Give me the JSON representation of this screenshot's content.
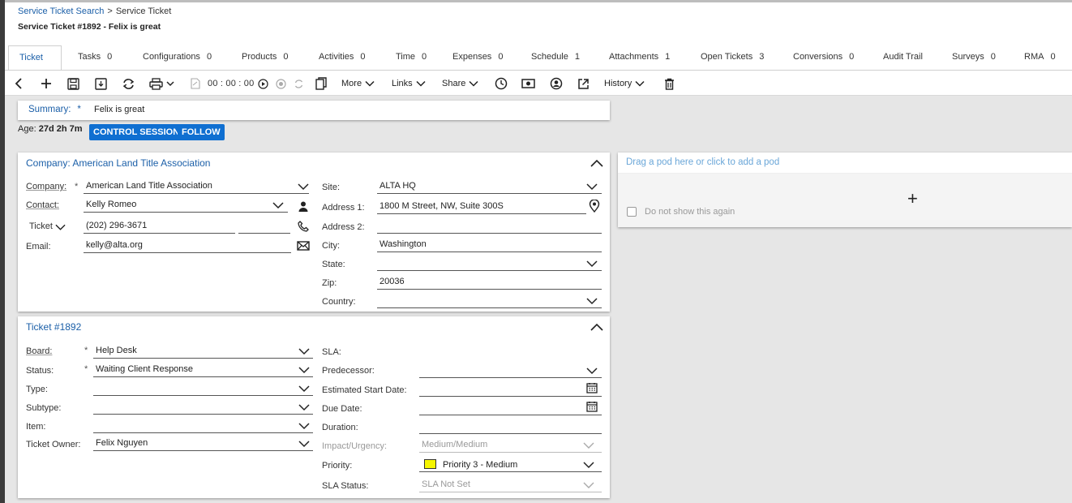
{
  "breadcrumb": {
    "parent": "Service Ticket Search",
    "separator": ">",
    "current": "Service Ticket"
  },
  "page_title": "Service Ticket #1892 - Felix is great",
  "tabs": [
    {
      "label": "Ticket",
      "count": ""
    },
    {
      "label": "Tasks",
      "count": "0"
    },
    {
      "label": "Configurations",
      "count": "0"
    },
    {
      "label": "Products",
      "count": "0"
    },
    {
      "label": "Activities",
      "count": "0"
    },
    {
      "label": "Time",
      "count": "0"
    },
    {
      "label": "Expenses",
      "count": "0"
    },
    {
      "label": "Schedule",
      "count": "1"
    },
    {
      "label": "Attachments",
      "count": "1"
    },
    {
      "label": "Open Tickets",
      "count": "3"
    },
    {
      "label": "Conversions",
      "count": "0"
    },
    {
      "label": "Audit Trail",
      "count": ""
    },
    {
      "label": "Surveys",
      "count": "0"
    },
    {
      "label": "RMA",
      "count": "0"
    }
  ],
  "toolbar": {
    "timer": "00 : 00 : 00",
    "more": "More",
    "links": "Links",
    "share": "Share",
    "history": "History"
  },
  "summary": {
    "label": "Summary:",
    "required": "*",
    "value": "Felix is great"
  },
  "age": {
    "label": "Age:",
    "value": "27d 2h 7m"
  },
  "buttons": {
    "control_session": "CONTROL SESSION",
    "follow": "FOLLOW"
  },
  "company_section": {
    "title": "Company: American Land Title Association",
    "company_label": "Company:",
    "company_value": "American Land Title Association",
    "contact_label": "Contact:",
    "contact_value": "Kelly Romeo",
    "phone_type": "Ticket",
    "phone_value": "(202) 296-3671",
    "email_label": "Email:",
    "email_value": "kelly@alta.org",
    "site_label": "Site:",
    "site_value": "ALTA HQ",
    "address1_label": "Address 1:",
    "address1_value": "1800 M Street, NW, Suite 300S",
    "address2_label": "Address 2:",
    "address2_value": "",
    "city_label": "City:",
    "city_value": "Washington",
    "state_label": "State:",
    "state_value": "",
    "zip_label": "Zip:",
    "zip_value": "20036",
    "country_label": "Country:",
    "country_value": ""
  },
  "ticket_section": {
    "title": "Ticket #1892",
    "board_label": "Board:",
    "board_value": "Help Desk",
    "status_label": "Status:",
    "status_value": "Waiting Client Response",
    "type_label": "Type:",
    "type_value": "",
    "subtype_label": "Subtype:",
    "subtype_value": "",
    "item_label": "Item:",
    "item_value": "",
    "owner_label": "Ticket Owner:",
    "owner_value": "Felix Nguyen",
    "sla_label": "SLA:",
    "predecessor_label": "Predecessor:",
    "predecessor_value": "",
    "est_start_label": "Estimated Start Date:",
    "est_start_value": "",
    "due_label": "Due Date:",
    "due_value": "",
    "duration_label": "Duration:",
    "duration_value": "",
    "impact_label": "Impact/Urgency:",
    "impact_value": "Medium/Medium",
    "priority_label": "Priority:",
    "priority_value": "Priority 3 - Medium",
    "priority_color": "#f5f500",
    "sla_status_label": "SLA Status:",
    "sla_status_value": "SLA Not Set"
  },
  "pod": {
    "title": "Drag a pod here or click to add a pod",
    "plus": "+",
    "checkbox_label": "Do not show this again"
  },
  "colors": {
    "accent": "#1b5fa8",
    "button": "#0f6fd1",
    "priority": "#f5f500"
  }
}
